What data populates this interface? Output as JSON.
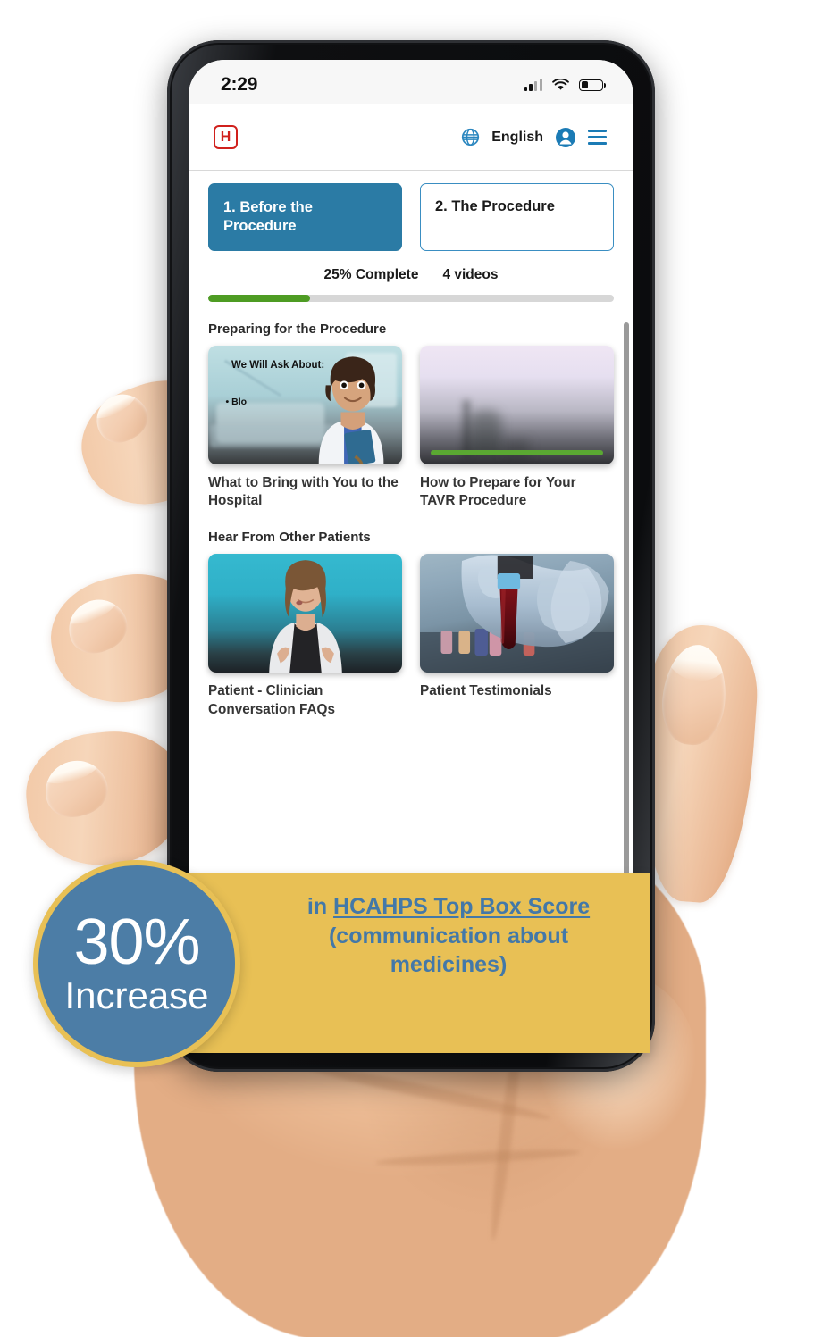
{
  "phone": {
    "statusbar": {
      "time": "2:29",
      "signal_icon": "cellular-signal-icon",
      "wifi_icon": "wifi-icon",
      "battery_icon": "battery-icon"
    },
    "header": {
      "logo_letter": "H",
      "logo_name": "hospital-logo",
      "globe_icon": "globe-icon",
      "language": "English",
      "account_icon": "account-icon",
      "menu_icon": "hamburger-menu-icon"
    },
    "tabs": [
      {
        "label": "1. Before the Procedure",
        "active": true
      },
      {
        "label": "2. The Procedure",
        "active": false
      }
    ],
    "progress": {
      "complete_label": "25% Complete",
      "videos_label": "4 videos",
      "percent": 25,
      "fill_color": "#4e9c23",
      "track_color": "#d7d7d7"
    },
    "sections": [
      {
        "title": "Preparing for the Procedure",
        "cards": [
          {
            "label": "What to Bring with You to the Hospital",
            "thumb_type": "illustration-clinician",
            "thumb_text_title": "We Will Ask About:",
            "thumb_text_bullet": "• Blo",
            "watched_percent": 0
          },
          {
            "label": "How to Prepare for Your TAVR Procedure",
            "thumb_type": "lavender-gradient",
            "watched_percent": 100
          }
        ]
      },
      {
        "title": "Hear From Other Patients",
        "cards": [
          {
            "label": "Patient - Clinician Conversation FAQs",
            "thumb_type": "teal-clinician-video",
            "watched_percent": 0
          },
          {
            "label": "Patient Testimonials",
            "thumb_type": "blood-vial-photo",
            "watched_percent": 0
          }
        ]
      }
    ]
  },
  "callout": {
    "badge_percent": "30%",
    "badge_word": "Increase",
    "line1_prefix": "in ",
    "line1_underlined": "HCAHPS Top Box Score",
    "line2": "(communication about",
    "line3": "medicines)",
    "badge_color": "#4c7da6",
    "banner_color": "#e8c055",
    "text_color": "#4378a8"
  }
}
